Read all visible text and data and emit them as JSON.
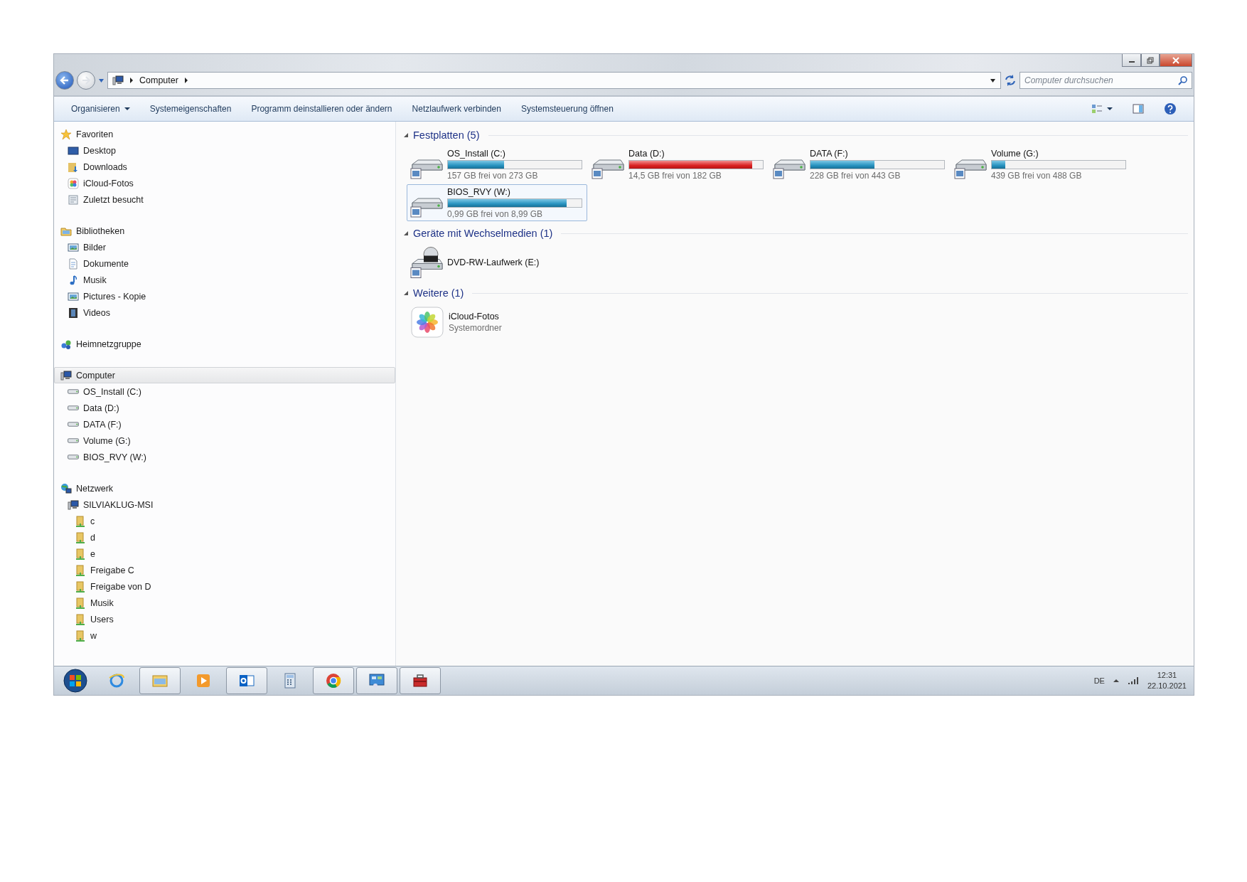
{
  "address_bar": {
    "crumbs": [
      "Computer"
    ],
    "search": {
      "placeholder": "Computer durchsuchen"
    }
  },
  "toolbar": [
    {
      "label": "Organisieren",
      "dropdown": true
    },
    {
      "label": "Systemeigenschaften",
      "dropdown": false
    },
    {
      "label": "Programm deinstallieren oder ändern",
      "dropdown": false
    },
    {
      "label": "Netzlaufwerk verbinden",
      "dropdown": false
    },
    {
      "label": "Systemsteuerung öffnen",
      "dropdown": false
    }
  ],
  "sidebar": [
    {
      "label": "Favoriten",
      "kind": "star",
      "selected": false,
      "children": [
        {
          "label": "Desktop",
          "kind": "desktop",
          "selected": false
        },
        {
          "label": "Downloads",
          "kind": "downloads",
          "selected": false
        },
        {
          "label": "iCloud-Fotos",
          "kind": "photos",
          "selected": false
        },
        {
          "label": "Zuletzt besucht",
          "kind": "recent",
          "selected": false
        }
      ]
    },
    {
      "label": "Bibliotheken",
      "kind": "library",
      "selected": false,
      "children": [
        {
          "label": "Bilder",
          "kind": "pictures",
          "selected": false
        },
        {
          "label": "Dokumente",
          "kind": "document",
          "selected": false
        },
        {
          "label": "Musik",
          "kind": "music",
          "selected": false
        },
        {
          "label": "Pictures - Kopie",
          "kind": "pictures",
          "selected": false
        },
        {
          "label": "Videos",
          "kind": "video",
          "selected": false
        }
      ]
    },
    {
      "label": "Heimnetzgruppe",
      "kind": "homegroup",
      "selected": false
    },
    {
      "label": "Computer",
      "kind": "computer",
      "selected": true,
      "children": [
        {
          "label": "OS_Install (C:)",
          "kind": "drive",
          "selected": false
        },
        {
          "label": "Data (D:)",
          "kind": "drive",
          "selected": false
        },
        {
          "label": "DATA (F:)",
          "kind": "drive",
          "selected": false
        },
        {
          "label": "Volume (G:)",
          "kind": "drive",
          "selected": false
        },
        {
          "label": "BIOS_RVY (W:)",
          "kind": "drive",
          "selected": false
        }
      ]
    },
    {
      "label": "Netzwerk",
      "kind": "network",
      "selected": false,
      "children": [
        {
          "label": "SILVIAKLUG-MSI",
          "kind": "computer",
          "selected": false,
          "children": [
            {
              "label": "c",
              "kind": "share",
              "selected": false
            },
            {
              "label": "d",
              "kind": "share",
              "selected": false
            },
            {
              "label": "e",
              "kind": "share",
              "selected": false
            },
            {
              "label": "Freigabe C",
              "kind": "share",
              "selected": false
            },
            {
              "label": "Freigabe von D",
              "kind": "share",
              "selected": false
            },
            {
              "label": "Musik",
              "kind": "share",
              "selected": false
            },
            {
              "label": "Users",
              "kind": "share",
              "selected": false
            },
            {
              "label": "w",
              "kind": "share",
              "selected": false
            }
          ]
        }
      ]
    }
  ],
  "sections": [
    {
      "title": "Festplatten (5)",
      "expanded": true,
      "items": [
        {
          "kind": "drive",
          "name": "OS_Install (C:)",
          "detail": "157 GB frei von 273 GB",
          "level": 0.42,
          "selected": false
        },
        {
          "kind": "drive",
          "name": "Data (D:)",
          "detail": "14,5 GB frei von 182 GB",
          "level": 0.92,
          "selected": false
        },
        {
          "kind": "drive",
          "name": "DATA (F:)",
          "detail": "228 GB frei von 443 GB",
          "level": 0.48,
          "selected": false
        },
        {
          "kind": "drive",
          "name": "Volume (G:)",
          "detail": "439 GB frei von 488 GB",
          "level": 0.1,
          "selected": false
        },
        {
          "kind": "drive",
          "name": "BIOS_RVY (W:)",
          "detail": "0,99 GB frei von 8,99 GB",
          "level": 0.89,
          "selected": true
        }
      ]
    },
    {
      "title": "Geräte mit Wechselmedien (1)",
      "expanded": true,
      "items": [
        {
          "kind": "dvd",
          "name": "DVD-RW-Laufwerk (E:)",
          "selected": false
        }
      ]
    },
    {
      "title": "Weitere (1)",
      "expanded": true,
      "items": [
        {
          "kind": "folder",
          "name": "iCloud-Fotos",
          "detail": "Systemordner",
          "selected": false
        }
      ]
    }
  ],
  "taskbar": {
    "apps": [
      {
        "kind": "browser",
        "running": false
      },
      {
        "kind": "explorer",
        "running": true
      },
      {
        "kind": "media",
        "running": false
      },
      {
        "kind": "mail",
        "running": true
      },
      {
        "kind": "calculator",
        "running": false
      },
      {
        "kind": "chrome",
        "running": true
      },
      {
        "kind": "control",
        "running": true
      },
      {
        "kind": "toolbox",
        "running": true
      }
    ],
    "language": "DE",
    "time": "12:31",
    "date": "22.10.2021"
  }
}
